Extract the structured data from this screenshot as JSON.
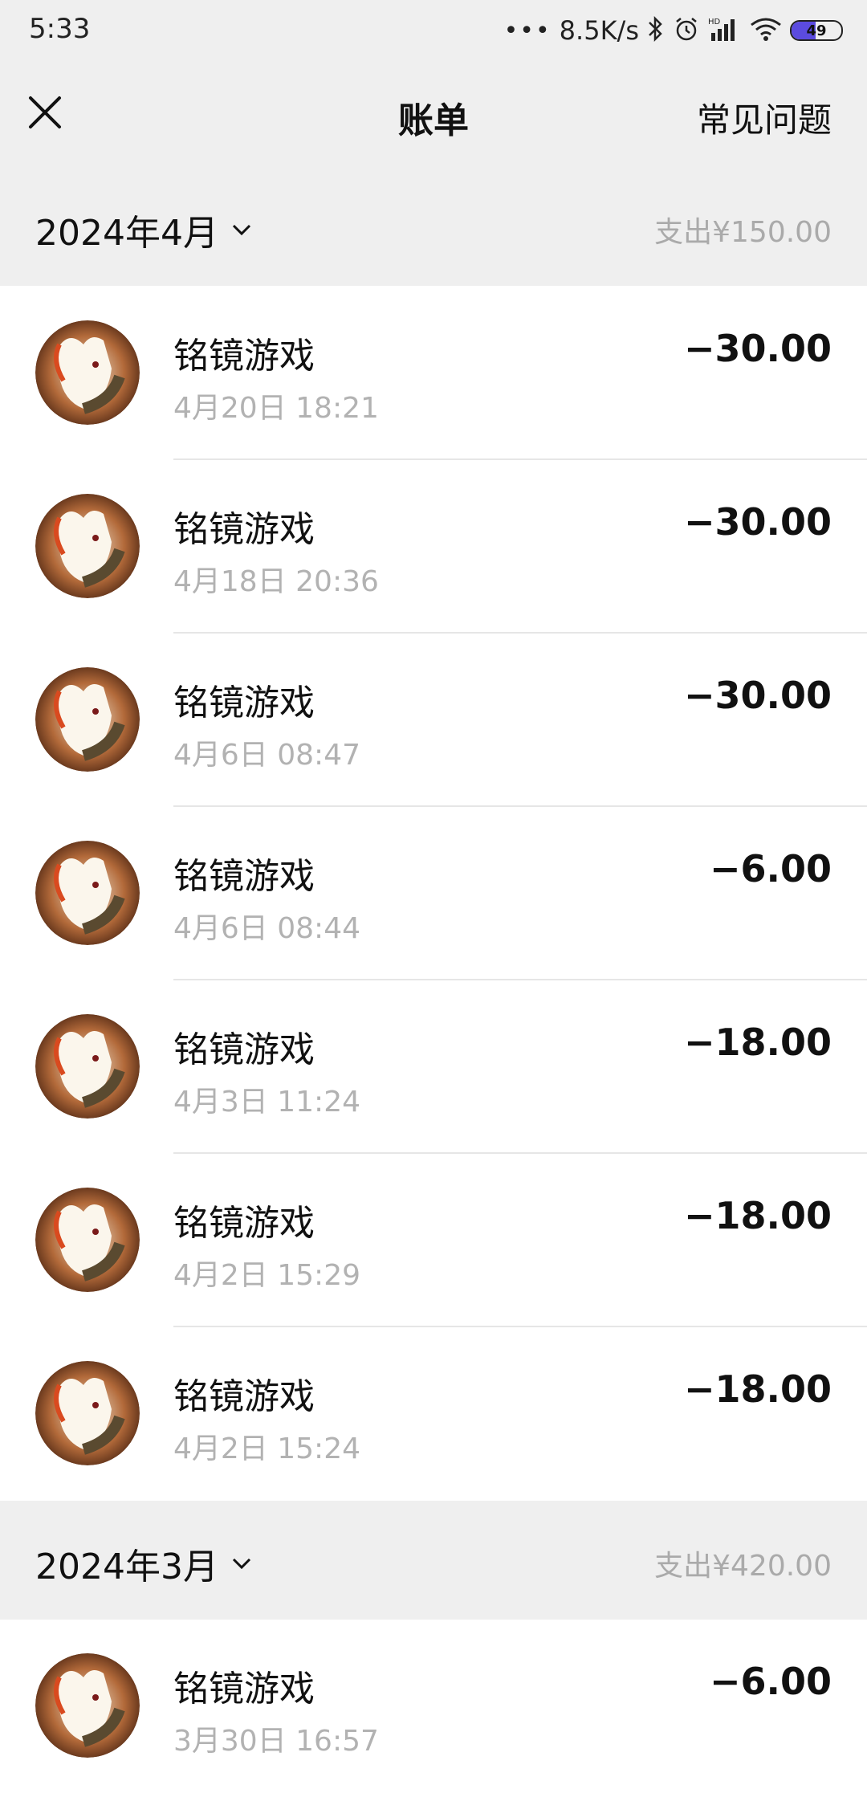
{
  "status_bar": {
    "time": "5:33",
    "net_speed": "8.5K/s",
    "battery": "49",
    "icons": [
      "more-dots-icon",
      "bluetooth-icon",
      "alarm-icon",
      "hd-signal-icon",
      "wifi-icon",
      "battery-icon"
    ]
  },
  "navbar": {
    "title": "账单",
    "faq": "常见问题",
    "close_icon": "close-icon"
  },
  "months": [
    {
      "label": "2024年4月",
      "expense": "支出¥150.00",
      "transactions": [
        {
          "merchant": "铭镜游戏",
          "time": "4月20日 18:21",
          "amount": "−30.00"
        },
        {
          "merchant": "铭镜游戏",
          "time": "4月18日 20:36",
          "amount": "−30.00"
        },
        {
          "merchant": "铭镜游戏",
          "time": "4月6日 08:47",
          "amount": "−30.00"
        },
        {
          "merchant": "铭镜游戏",
          "time": "4月6日 08:44",
          "amount": "−6.00"
        },
        {
          "merchant": "铭镜游戏",
          "time": "4月3日 11:24",
          "amount": "−18.00"
        },
        {
          "merchant": "铭镜游戏",
          "time": "4月2日 15:29",
          "amount": "−18.00"
        },
        {
          "merchant": "铭镜游戏",
          "time": "4月2日 15:24",
          "amount": "−18.00"
        }
      ]
    },
    {
      "label": "2024年3月",
      "expense": "支出¥420.00",
      "transactions": [
        {
          "merchant": "铭镜游戏",
          "time": "3月30日 16:57",
          "amount": "−6.00"
        }
      ]
    }
  ],
  "colors": {
    "header_bg": "#efefef",
    "muted_text": "#b2b2b2",
    "battery_fill": "#5b4be0"
  }
}
